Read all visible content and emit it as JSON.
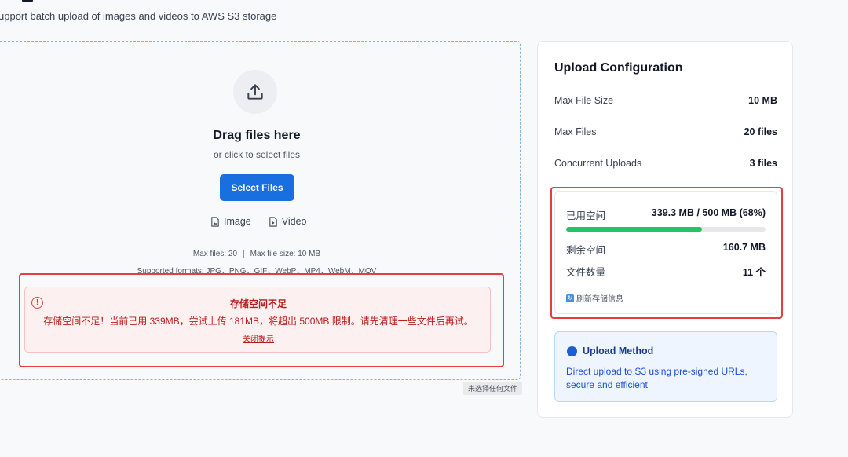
{
  "page": {
    "subtitle": "upport batch upload of images and videos to AWS S3 storage"
  },
  "dropzone": {
    "icon": "upload-icon",
    "title": "Drag files here",
    "subtitle": "or click to select files",
    "select_button": "Select Files",
    "types": [
      {
        "icon": "image-file-icon",
        "label": "Image"
      },
      {
        "icon": "video-file-icon",
        "label": "Video"
      }
    ],
    "max_files": "Max files: 20",
    "separator": "|",
    "max_file_size": "Max file size: 10 MB",
    "formats": "Supported formats: JPG、PNG、GIF、WebP、MP4、WebM、MOV"
  },
  "error": {
    "icon": "alert-circle-icon",
    "title": "存储空间不足",
    "message": "存储空间不足！当前已用 339MB，尝试上传 181MB，将超出 500MB 限制。请先清理一些文件后再试。",
    "close_label": "关闭提示"
  },
  "file_input_tooltip": "未选择任何文件",
  "config": {
    "title": "Upload Configuration",
    "rows": [
      {
        "label": "Max File Size",
        "value": "10 MB"
      },
      {
        "label": "Max Files",
        "value": "20 files"
      },
      {
        "label": "Concurrent Uploads",
        "value": "3 files"
      }
    ]
  },
  "storage": {
    "used_label": "已用空间",
    "used_value": "339.3 MB / 500 MB (68%)",
    "used_fraction": 0.68,
    "remaining_label": "剩余空间",
    "remaining_value": "160.7 MB",
    "count_label": "文件数量",
    "count_value": "11 个",
    "refresh_label": "刷新存储信息",
    "refresh_icon": "refresh-icon"
  },
  "upload_method": {
    "title": "Upload Method",
    "description": "Direct upload to S3 using pre-signed URLs, secure and efficient"
  },
  "colors": {
    "primary": "#1a6fe0",
    "error": "#b91c1c",
    "highlight": "#e53e3e",
    "progress": "#22c55e",
    "method_bg": "#eef5ff"
  }
}
